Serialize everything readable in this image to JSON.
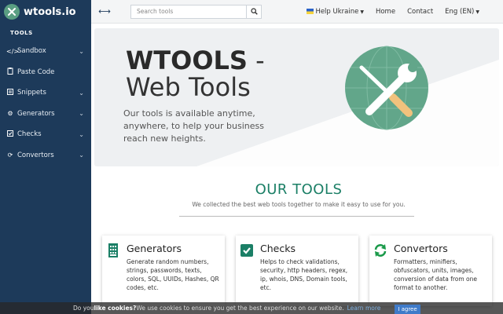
{
  "brand": {
    "name": "wtools.io"
  },
  "sidebar": {
    "section_label": "TOOLS",
    "items": [
      {
        "label": "Sandbox",
        "icon": "code-icon",
        "has_submenu": true
      },
      {
        "label": "Paste Code",
        "icon": "paste-icon",
        "has_submenu": false
      },
      {
        "label": "Snippets",
        "icon": "snippets-icon",
        "has_submenu": true
      },
      {
        "label": "Generators",
        "icon": "cogs-icon",
        "has_submenu": true
      },
      {
        "label": "Checks",
        "icon": "check-icon",
        "has_submenu": true
      },
      {
        "label": "Convertors",
        "icon": "sync-icon",
        "has_submenu": true
      }
    ]
  },
  "topbar": {
    "search_placeholder": "Search tools",
    "links": {
      "ukraine": "Help Ukraine",
      "home": "Home",
      "contact": "Contact",
      "language": "Eng (EN)"
    }
  },
  "hero": {
    "title_bold": "WTOOLS",
    "title_dash": " -",
    "title_line2": "Web Tools",
    "description": "Our tools is available anytime, anywhere, to help your business reach new heights."
  },
  "tools": {
    "title": "OUR TOOLS",
    "subtitle": "We collected the best web tools together to make it easy to use for you.",
    "cards": [
      {
        "title": "Generators",
        "icon": "grid-calculator-icon",
        "description": "Generate random numbers, strings, passwords, texts, colors, SQL, UUIDs, Hashes, QR codes, etc."
      },
      {
        "title": "Checks",
        "icon": "check-square-icon",
        "description": "Helps to check validations, security, http headers, regex, ip, whois, DNS, Domain tools, etc."
      },
      {
        "title": "Convertors",
        "icon": "sync-arrows-icon",
        "description": "Formatters, minifiers, obfuscators, units, images, conversion of data from one format to another."
      }
    ]
  },
  "cookie": {
    "prefix": "Do you ",
    "bold": "like cookies?",
    "text": " We use cookies to ensure you get the best experience on our website.",
    "learn_more": "Learn more",
    "agree": "I agree"
  },
  "colors": {
    "sidebar": "#1d3a5a",
    "accent": "#1b7f66",
    "emblem": "#5a9e82"
  }
}
